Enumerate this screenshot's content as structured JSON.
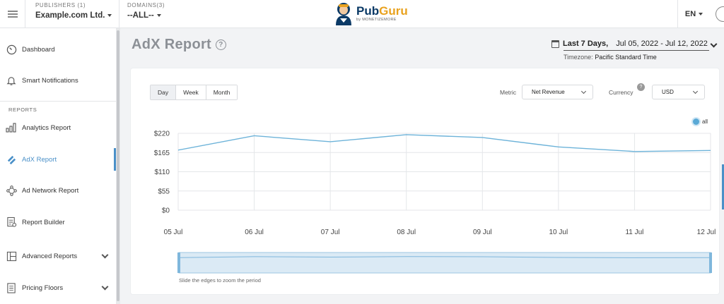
{
  "header": {
    "publishers_label": "PUBLISHERS (1)",
    "publisher_value": "Example.com Ltd.",
    "domains_label": "DOMAINS(3)",
    "domain_value": "--ALL--",
    "logo_name": "PubGuru",
    "logo_sub": "by MONETIZEMORE",
    "language": "EN"
  },
  "sidebar": {
    "items": [
      {
        "label": "Dashboard",
        "icon": "gauge-icon"
      },
      {
        "label": "Smart Notifications",
        "icon": "bell-icon"
      },
      {
        "label": "Analytics Report",
        "icon": "bar-chart-icon"
      },
      {
        "label": "AdX Report",
        "icon": "adx-icon"
      },
      {
        "label": "Ad Network Report",
        "icon": "network-icon"
      },
      {
        "label": "Report Builder",
        "icon": "builder-icon"
      },
      {
        "label": "Advanced Reports",
        "icon": "layout-icon"
      },
      {
        "label": "Pricing Floors",
        "icon": "document-icon"
      }
    ],
    "section_label": "REPORTS"
  },
  "page": {
    "title": "AdX Report",
    "help": "?",
    "date_range_label": "Last 7 Days,",
    "date_range_dates": "Jul 05, 2022 - Jul 12, 2022",
    "timezone_label": "Timezone:",
    "timezone_value": "Pacific Standard Time"
  },
  "controls": {
    "period_options": [
      "Day",
      "Week",
      "Month"
    ],
    "selected_period": "Day",
    "metric_label": "Metric",
    "metric_value": "Net Revenue",
    "currency_label": "Currency",
    "currency_help": "?",
    "currency_value": "USD"
  },
  "navigator_hint": "Slide the edges to zoom the period",
  "colors": {
    "accent": "#4a90c8",
    "series": "#6db3d9",
    "title_gray": "#8c9096"
  },
  "chart_data": {
    "type": "line",
    "categories": [
      "05 Jul",
      "06 Jul",
      "07 Jul",
      "08 Jul",
      "09 Jul",
      "10 Jul",
      "11 Jul",
      "12 Jul"
    ],
    "series": [
      {
        "name": "all",
        "values": [
          172,
          213,
          196,
          216,
          208,
          181,
          168,
          171
        ]
      }
    ],
    "y_ticks": [
      "$0",
      "$55",
      "$110",
      "$165",
      "$220"
    ],
    "ylim": [
      0,
      220
    ],
    "grid": true,
    "legend": "top-right"
  }
}
